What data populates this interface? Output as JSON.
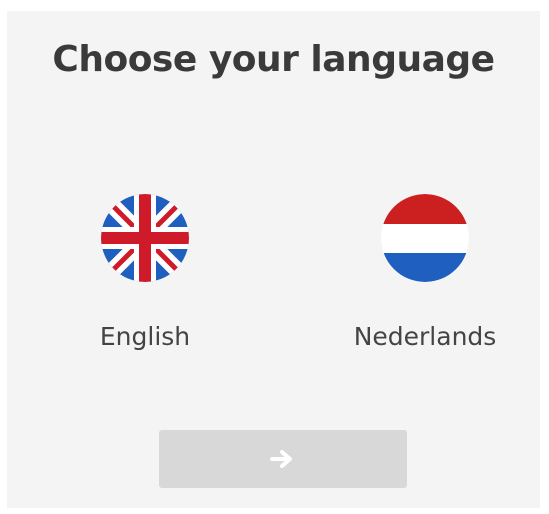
{
  "heading": "Choose your language",
  "languages": [
    {
      "label": "English",
      "flag": "uk-flag-icon"
    },
    {
      "label": "Nederlands",
      "flag": "netherlands-flag-icon"
    }
  ],
  "next_button": {
    "icon": "arrow-right-icon"
  },
  "colors": {
    "panel_bg": "#f4f4f4",
    "button_bg": "#d8d8d8",
    "nl_red": "#cc1f1f",
    "nl_white": "#ffffff",
    "nl_blue": "#1f5fc0",
    "uk_blue": "#1f5fc0",
    "uk_red": "#cf1a2a"
  }
}
